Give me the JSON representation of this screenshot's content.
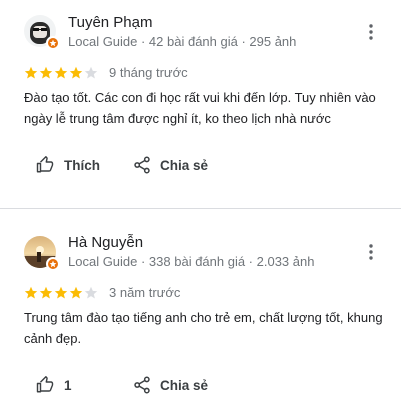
{
  "reviews": [
    {
      "name": "Tuyên Phạm",
      "meta": "Local Guide · 42 bài đánh giá · 295 ảnh",
      "rating": 4,
      "when": "9 tháng trước",
      "text": "Đào tạo tốt. Các con đi học rất vui khi đến lớp. Tuy nhiên vào ngày lễ trung tâm được nghỉ ít, ko theo lịch nhà nước",
      "like_label": "Thích",
      "share_label": "Chia sẻ"
    },
    {
      "name": "Hà Nguyễn",
      "meta": "Local Guide · 338 bài đánh giá · 2.033 ảnh",
      "rating": 4,
      "when": "3 năm trước",
      "text": "Trung tâm đào tạo tiếng anh cho trẻ em, chất lượng tốt, khung cảnh đẹp.",
      "like_label": "1",
      "share_label": "Chia sẻ"
    }
  ],
  "colors": {
    "star_filled": "#fbbc04",
    "star_empty": "#dadce0",
    "badge": "#e8710a",
    "meta_text": "#70757a",
    "divider": "#dadce0"
  },
  "icons": {
    "badge": "local-guide-star-icon",
    "more": "more-vert-icon",
    "like": "thumb-up-icon",
    "share": "share-icon"
  }
}
